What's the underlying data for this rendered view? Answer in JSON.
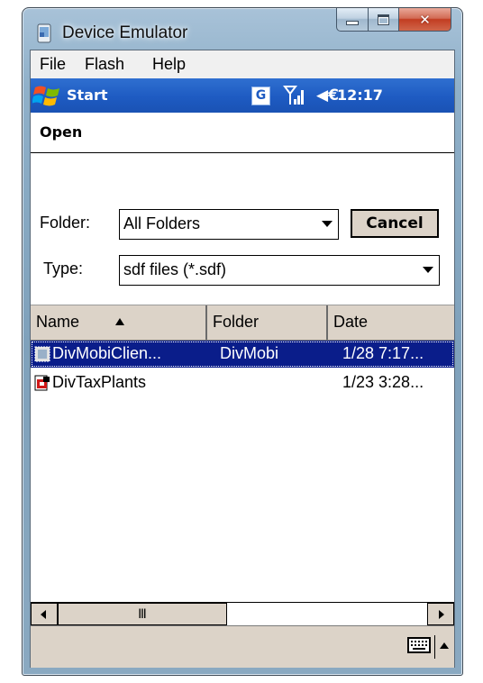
{
  "window": {
    "title": "Device Emulator"
  },
  "menubar": {
    "items": [
      "File",
      "Flash",
      "Help"
    ]
  },
  "startbar": {
    "start_label": "Start",
    "network_badge": "G",
    "volume_glyph": "◀€",
    "clock": "12:17"
  },
  "dialog": {
    "title": "Open",
    "folder_label": "Folder:",
    "folder_value": "All Folders",
    "type_label": "Type:",
    "type_value": "sdf files (*.sdf)",
    "cancel_label": "Cancel"
  },
  "listview": {
    "columns": [
      "Name",
      "Folder",
      "Date"
    ],
    "sort_column": "Name",
    "sort_direction": "ascending",
    "rows": [
      {
        "name": "DivMobiClien...",
        "folder": "DivMobi",
        "date": "1/28 7:17...",
        "selected": true,
        "icon": "database-file-icon"
      },
      {
        "name": "DivTaxPlants",
        "folder": "",
        "date": "1/23 3:28...",
        "selected": false,
        "icon": "sdf-file-icon"
      }
    ]
  },
  "scrollbar": {
    "thumb_grip": "Ⅲ"
  },
  "colors": {
    "startbar_blue": "#1e5bc2",
    "selection_blue": "#0a1d8a",
    "chrome_beige": "#dcd3c8",
    "close_red": "#c23d22"
  }
}
